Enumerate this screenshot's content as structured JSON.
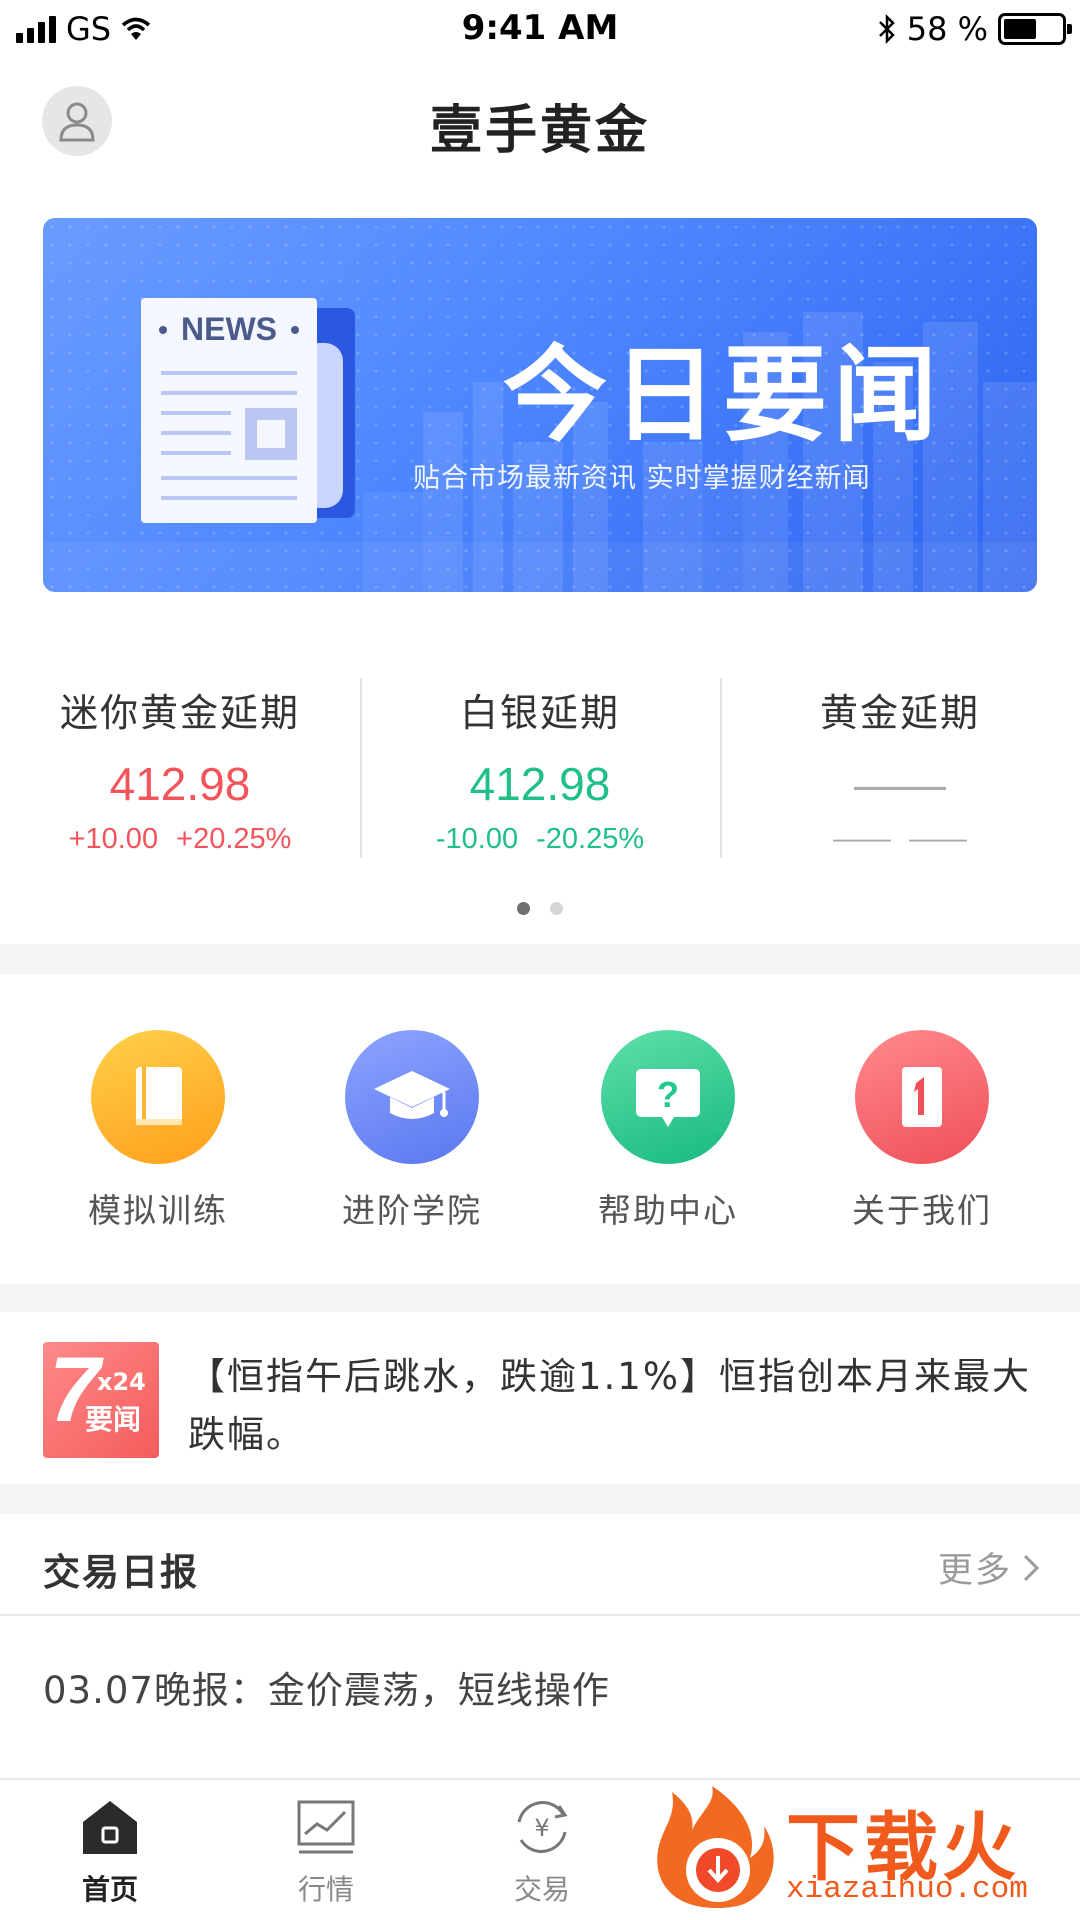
{
  "status_bar": {
    "carrier": "GS",
    "time": "9:41 AM",
    "battery_percent": "58 %",
    "battery_level": 0.58
  },
  "header": {
    "title": "壹手黄金",
    "avatar_icon": "user-icon"
  },
  "banner": {
    "title": "今日要闻",
    "subtitle": "贴合市场最新资讯  实时掌握财经新闻",
    "news_label": "NEWS",
    "colors": {
      "start": "#6a9cff",
      "end": "#2d63f0"
    }
  },
  "quotes": [
    {
      "name": "迷你黄金延期",
      "price": "412.98",
      "change": "+10.00",
      "change_pct": "+20.25%",
      "trend": "up"
    },
    {
      "name": "白银延期",
      "price": "412.98",
      "change": "-10.00",
      "change_pct": "-20.25%",
      "trend": "down"
    },
    {
      "name": "黄金延期",
      "price": "——",
      "change": "——",
      "change_pct": "——",
      "trend": "none"
    }
  ],
  "carousel": {
    "page": 1,
    "total": 2
  },
  "features": [
    {
      "label": "模拟训练",
      "icon": "book-icon",
      "color": "#ffb62e"
    },
    {
      "label": "进阶学院",
      "icon": "graduation-cap-icon",
      "color": "#6f8bf7"
    },
    {
      "label": "帮助中心",
      "icon": "question-icon",
      "color": "#22c98d"
    },
    {
      "label": "关于我们",
      "icon": "about-icon",
      "color": "#f6626a"
    }
  ],
  "ticker": {
    "badge_big": "7",
    "badge_small": "x24",
    "badge_label": "要闻",
    "text": "【恒指午后跳水，跌逾1.1%】恒指创本月来最大跌幅。"
  },
  "report": {
    "title": "交易日报",
    "more": "更多",
    "items": [
      "03.07晚报：金价震荡，短线操作"
    ]
  },
  "tabbar": {
    "items": [
      {
        "label": "首页",
        "icon": "home-icon",
        "active": true
      },
      {
        "label": "行情",
        "icon": "chart-icon",
        "active": false
      },
      {
        "label": "交易",
        "icon": "exchange-icon",
        "active": false
      }
    ]
  },
  "watermark": {
    "text": "下载火",
    "url": "xiazaihuo.com"
  },
  "colors": {
    "up": "#f2545b",
    "down": "#1fbf85",
    "neutral": "#aaaaaa"
  }
}
